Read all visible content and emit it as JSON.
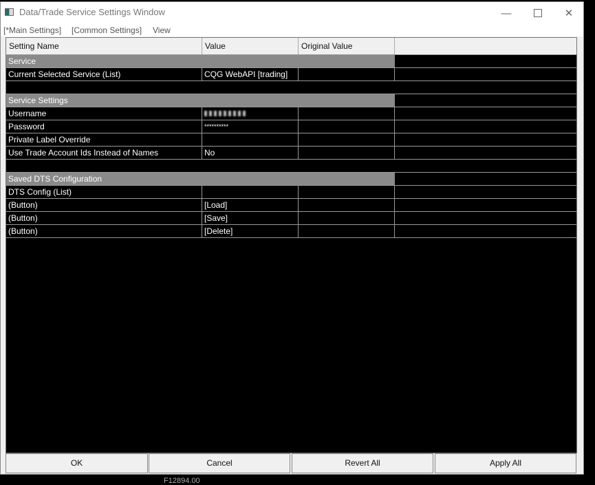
{
  "window": {
    "title": "Data/Trade Service Settings Window",
    "controls": [
      "minimize",
      "maximize",
      "close"
    ]
  },
  "menu": [
    "[*Main Settings]",
    "[Common Settings]",
    "View"
  ],
  "columns": [
    "Setting Name",
    "Value",
    "Original Value",
    ""
  ],
  "rows": [
    {
      "type": "section",
      "name": "Service"
    },
    {
      "type": "item",
      "name": "Current Selected Service (List)",
      "value": "CQG WebAPI    [trading]",
      "original": ""
    },
    {
      "type": "blank"
    },
    {
      "type": "section",
      "name": "Service Settings"
    },
    {
      "type": "item",
      "name": "Username",
      "value": "",
      "redacted": true,
      "original": ""
    },
    {
      "type": "item",
      "name": "Password",
      "value": "**********",
      "original": ""
    },
    {
      "type": "item",
      "name": "Private Label Override",
      "value": "",
      "original": ""
    },
    {
      "type": "item",
      "name": "Use Trade Account Ids Instead of Names",
      "value": "No",
      "original": ""
    },
    {
      "type": "blank"
    },
    {
      "type": "section",
      "name": "Saved DTS Configuration"
    },
    {
      "type": "item",
      "name": "DTS Config (List)",
      "value": "",
      "original": ""
    },
    {
      "type": "item",
      "name": "(Button)",
      "value": "[Load]",
      "original": ""
    },
    {
      "type": "item",
      "name": "(Button)",
      "value": "[Save]",
      "original": ""
    },
    {
      "type": "item",
      "name": "(Button)",
      "value": "[Delete]",
      "original": ""
    }
  ],
  "buttons": {
    "ok": "OK",
    "cancel": "Cancel",
    "revert": "Revert All",
    "apply": "Apply All"
  },
  "background": {
    "price_label": "F12894.00"
  },
  "colors": {
    "section_bg": "#8a8a8a",
    "grid_bg": "#000000",
    "grid_text": "#ffffff"
  }
}
